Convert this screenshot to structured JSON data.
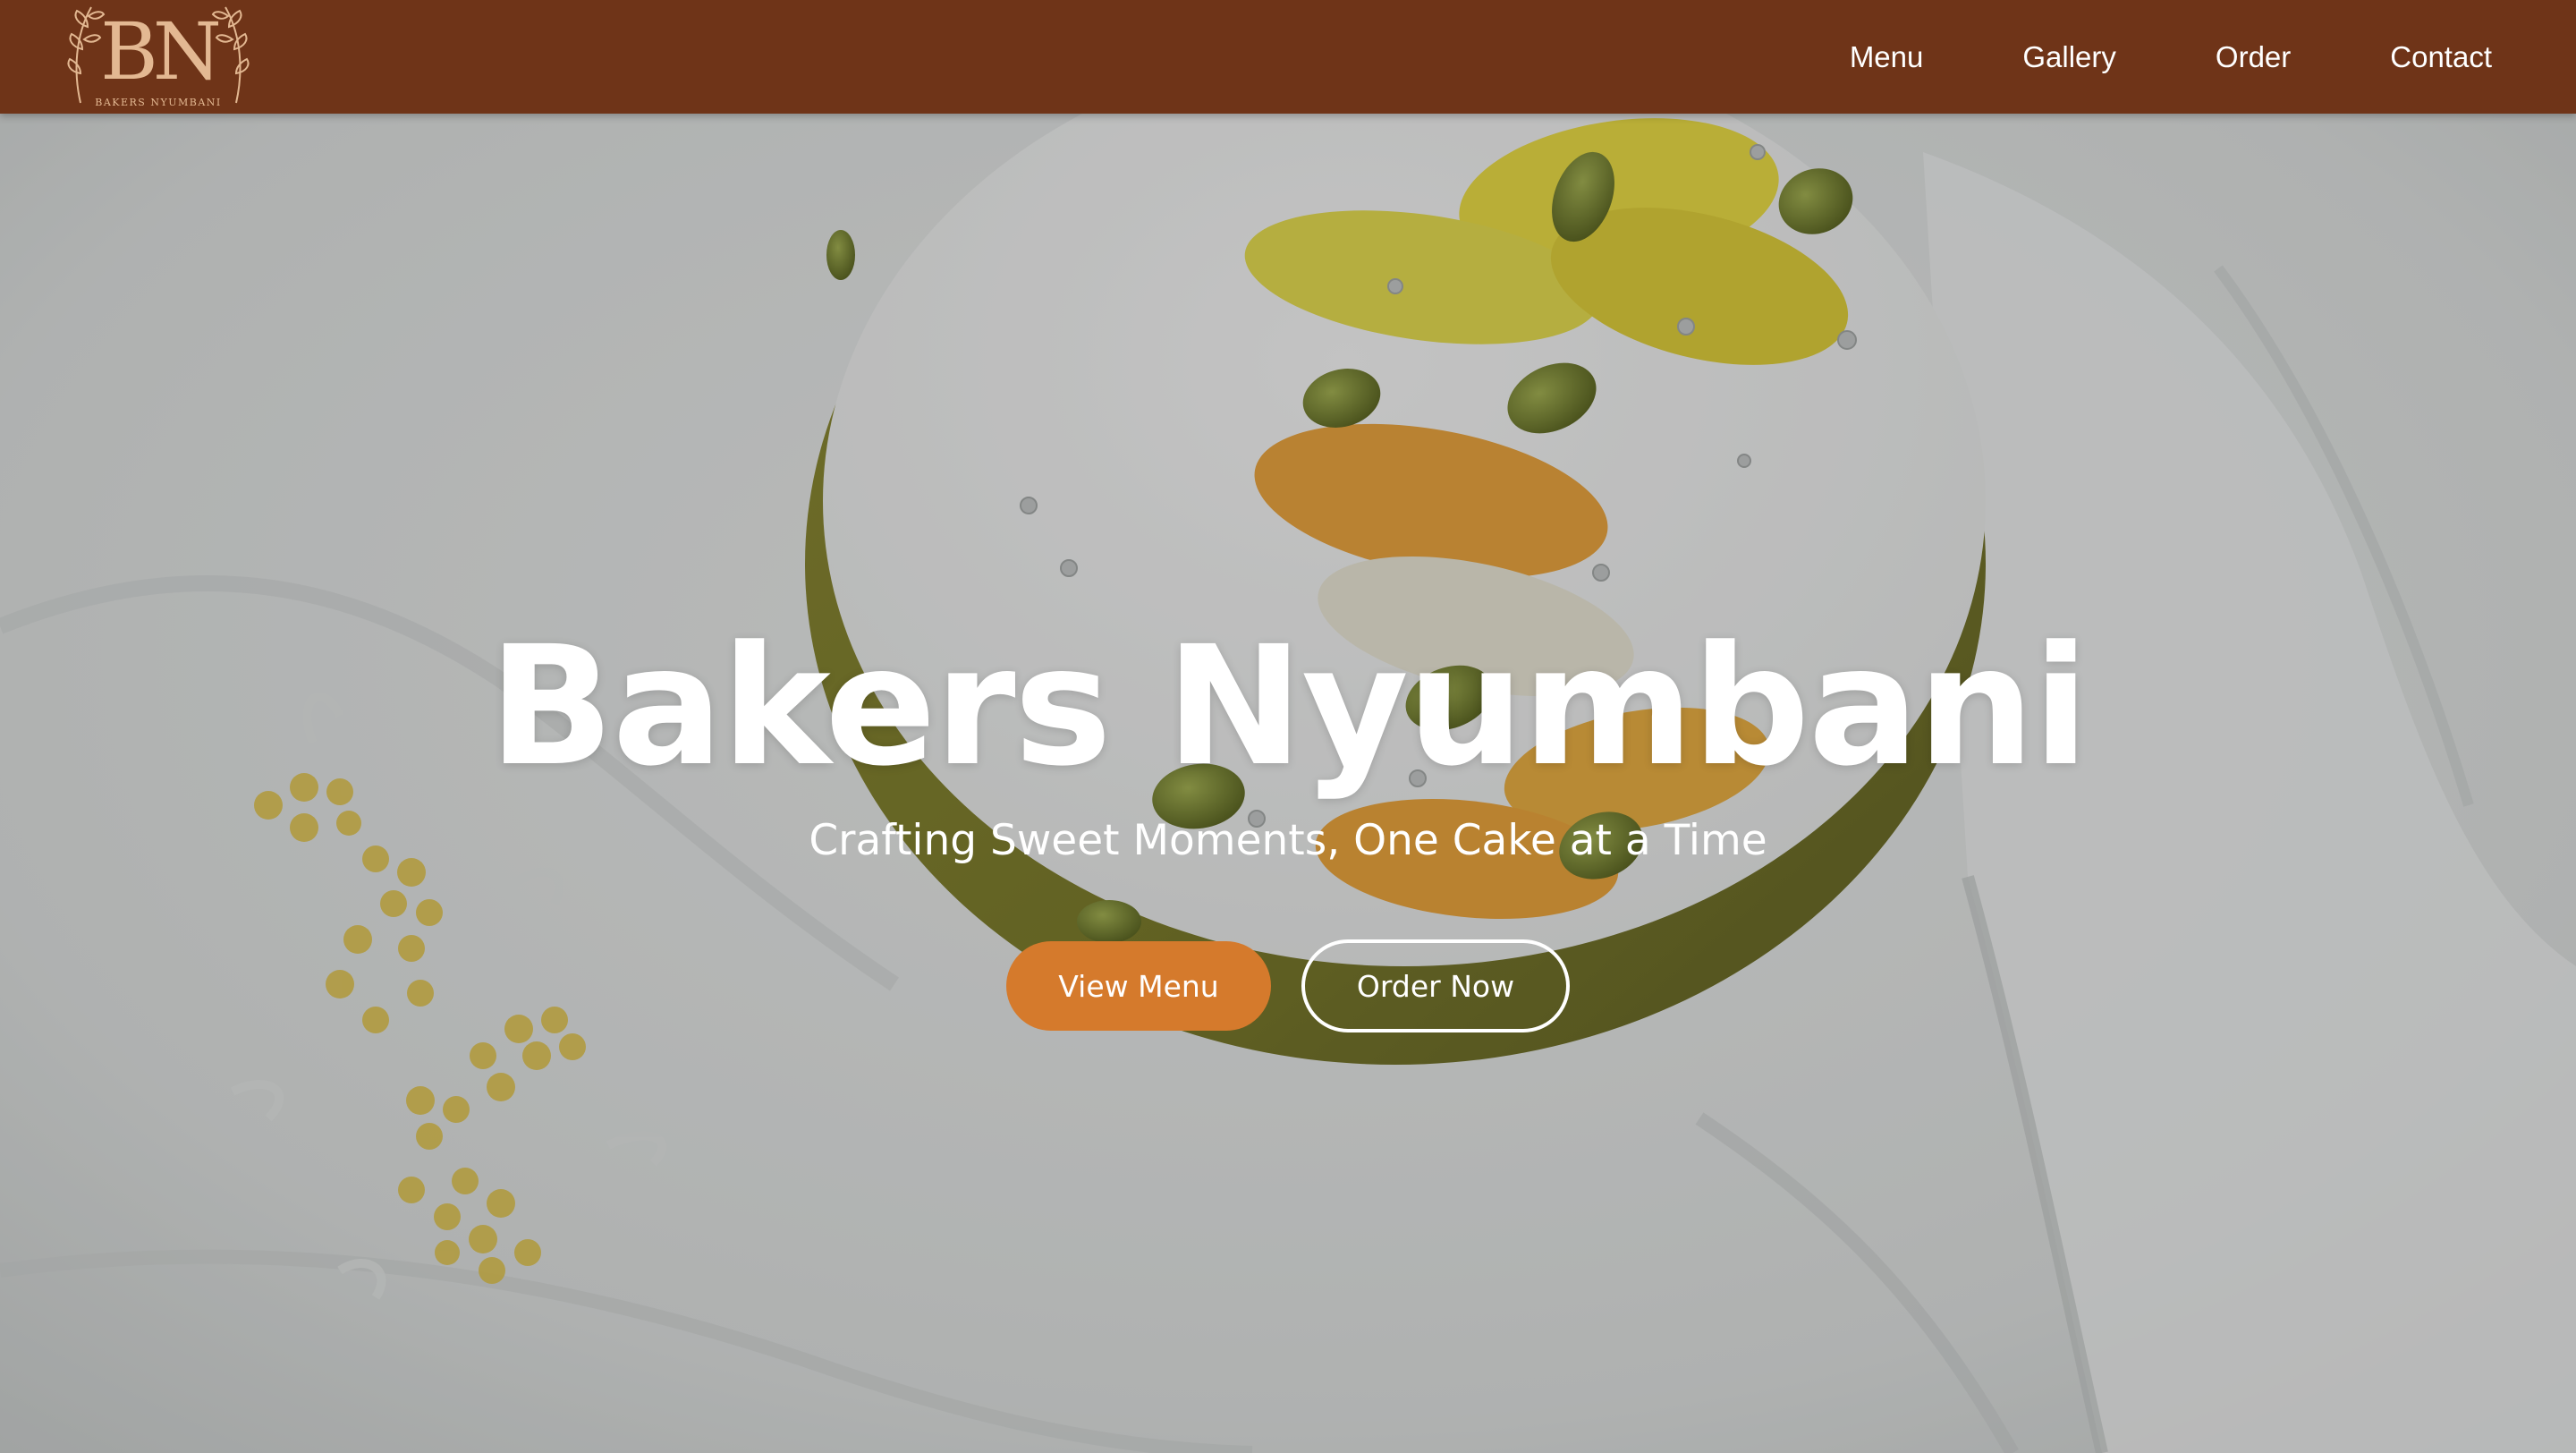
{
  "brand": {
    "logo_monogram": "BN",
    "logo_wordmark": "BAKERS NYUMBANI",
    "color_header": "#6f3418",
    "color_accent": "#d57a2c",
    "logo_color": "#e3b892"
  },
  "nav": {
    "items": [
      {
        "label": "Menu"
      },
      {
        "label": "Gallery"
      },
      {
        "label": "Order"
      },
      {
        "label": "Contact"
      }
    ]
  },
  "hero": {
    "title": "Bakers Nyumbani",
    "subtitle": "Crafting Sweet Moments, One Cake at a Time",
    "primary_button": "View Menu",
    "secondary_button": "Order Now",
    "background_image": "cake with yellow, orange and pistachio decorations on white embroidered linen"
  }
}
